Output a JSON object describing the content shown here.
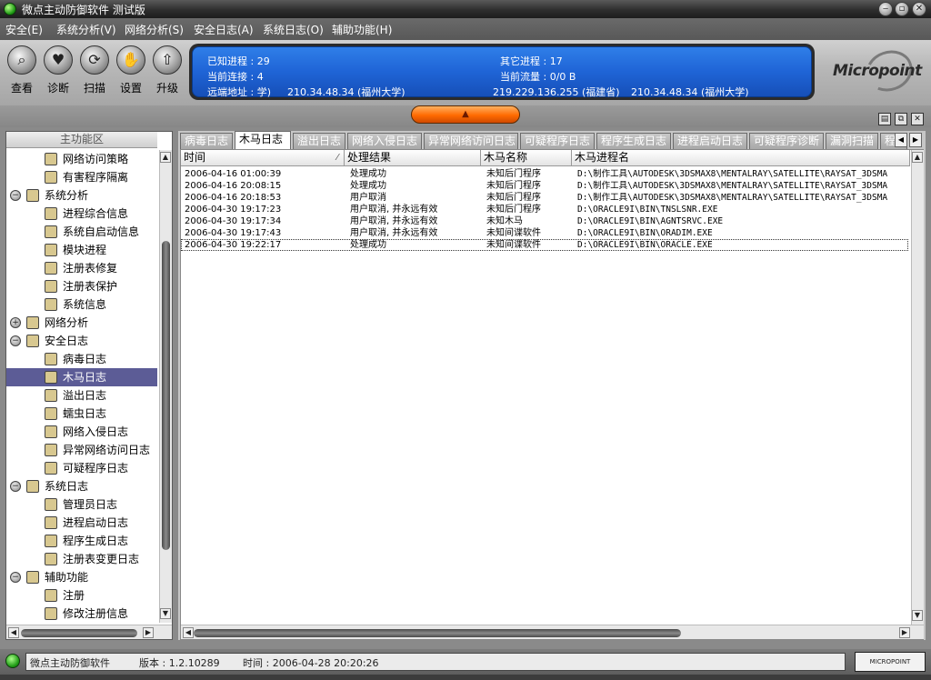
{
  "window": {
    "title": "微点主动防御软件  测试版",
    "buttons": {
      "minimize": "‒",
      "maximize": "▫",
      "close": "✕"
    }
  },
  "menu": [
    "安全(E)",
    "系统分析(V)",
    "网络分析(S)",
    "安全日志(A)",
    "系统日志(O)",
    "辅助功能(H)"
  ],
  "toolbar": {
    "buttons": [
      {
        "label": "查看",
        "icon": "magnifier-icon",
        "glyph": "⌕"
      },
      {
        "label": "诊断",
        "icon": "heart-icon",
        "glyph": "♥"
      },
      {
        "label": "扫描",
        "icon": "scan-icon",
        "glyph": "⟳"
      },
      {
        "label": "设置",
        "icon": "hand-icon",
        "glyph": "✋"
      },
      {
        "label": "升级",
        "icon": "upgrade-icon",
        "glyph": "⇧"
      }
    ]
  },
  "status_panel": {
    "known_processes": "已知进程 : 29",
    "other_processes": "其它进程 : 17",
    "current_connections": "当前连接 : 4",
    "current_traffic": "当前流量 : 0/0 B",
    "remote_label": "远端地址 : 学)",
    "remote_1": "210.34.48.34 (福州大学)",
    "remote_2": "219.229.136.255 (福建省)",
    "remote_3": "210.34.48.34 (福州大学)"
  },
  "logo": {
    "text": "Micropoint"
  },
  "collapse_button": {
    "glyph": "▲"
  },
  "view_controls": [
    "▤",
    "⧉",
    "✕"
  ],
  "left_panel": {
    "header": "主功能区",
    "tree": [
      {
        "label": "网络访问策略",
        "level": 1,
        "icon": "network-policy-icon"
      },
      {
        "label": "有害程序隔离",
        "level": 1,
        "icon": "isolation-icon"
      },
      {
        "label": "系统分析",
        "level": 0,
        "icon": "system-analysis-icon",
        "expander": "−"
      },
      {
        "label": "进程综合信息",
        "level": 1,
        "icon": "process-info-icon"
      },
      {
        "label": "系统自启动信息",
        "level": 1,
        "icon": "autostart-icon"
      },
      {
        "label": "模块进程",
        "level": 1,
        "icon": "module-icon"
      },
      {
        "label": "注册表修复",
        "level": 1,
        "icon": "registry-repair-icon"
      },
      {
        "label": "注册表保护",
        "level": 1,
        "icon": "registry-protect-icon"
      },
      {
        "label": "系统信息",
        "level": 1,
        "icon": "system-info-icon"
      },
      {
        "label": "网络分析",
        "level": 0,
        "icon": "network-analysis-icon",
        "expander": "+"
      },
      {
        "label": "安全日志",
        "level": 0,
        "icon": "security-log-icon",
        "expander": "−"
      },
      {
        "label": "病毒日志",
        "level": 1,
        "icon": "virus-log-icon"
      },
      {
        "label": "木马日志",
        "level": 1,
        "icon": "trojan-log-icon",
        "selected": true
      },
      {
        "label": "溢出日志",
        "level": 1,
        "icon": "overflow-log-icon"
      },
      {
        "label": "蠕虫日志",
        "level": 1,
        "icon": "worm-log-icon"
      },
      {
        "label": "网络入侵日志",
        "level": 1,
        "icon": "intrusion-log-icon"
      },
      {
        "label": "异常网络访问日志",
        "level": 1,
        "icon": "abnormal-access-log-icon"
      },
      {
        "label": "可疑程序日志",
        "level": 1,
        "icon": "suspicious-log-icon"
      },
      {
        "label": "系统日志",
        "level": 0,
        "icon": "system-log-icon",
        "expander": "−"
      },
      {
        "label": "管理员日志",
        "level": 1,
        "icon": "admin-log-icon"
      },
      {
        "label": "进程启动日志",
        "level": 1,
        "icon": "process-start-log-icon"
      },
      {
        "label": "程序生成日志",
        "level": 1,
        "icon": "program-gen-log-icon"
      },
      {
        "label": "注册表变更日志",
        "level": 1,
        "icon": "registry-change-log-icon"
      },
      {
        "label": "辅助功能",
        "level": 0,
        "icon": "assist-icon",
        "expander": "−"
      },
      {
        "label": "注册",
        "level": 1,
        "icon": "register-icon"
      },
      {
        "label": "修改注册信息",
        "level": 1,
        "icon": "modify-register-icon"
      }
    ]
  },
  "tabs": [
    {
      "label": "病毒日志"
    },
    {
      "label": "木马日志",
      "active": true
    },
    {
      "label": "溢出日志"
    },
    {
      "label": "网络入侵日志"
    },
    {
      "label": "异常网络访问日志"
    },
    {
      "label": "可疑程序日志"
    },
    {
      "label": "程序生成日志"
    },
    {
      "label": "进程启动日志"
    },
    {
      "label": "可疑程序诊断"
    },
    {
      "label": "漏洞扫描"
    },
    {
      "label": "程"
    }
  ],
  "table": {
    "columns": [
      "时间",
      "处理结果",
      "木马名称",
      "木马进程名"
    ],
    "sort_indicator": "⁄",
    "rows": [
      [
        "2006-04-16 01:00:39",
        "处理成功",
        "未知后门程序",
        "D:\\制作工具\\AUTODESK\\3DSMAX8\\MENTALRAY\\SATELLITE\\RAYSAT_3DSMA"
      ],
      [
        "2006-04-16 20:08:15",
        "处理成功",
        "未知后门程序",
        "D:\\制作工具\\AUTODESK\\3DSMAX8\\MENTALRAY\\SATELLITE\\RAYSAT_3DSMA"
      ],
      [
        "2006-04-16 20:18:53",
        "用户取消",
        "未知后门程序",
        "D:\\制作工具\\AUTODESK\\3DSMAX8\\MENTALRAY\\SATELLITE\\RAYSAT_3DSMA"
      ],
      [
        "2006-04-30 19:17:23",
        "用户取消, 并永远有效",
        "未知后门程序",
        "D:\\ORACLE9I\\BIN\\TNSLSNR.EXE"
      ],
      [
        "2006-04-30 19:17:34",
        "用户取消, 并永远有效",
        "未知木马",
        "D:\\ORACLE9I\\BIN\\AGNTSRVC.EXE"
      ],
      [
        "2006-04-30 19:17:43",
        "用户取消, 并永远有效",
        "未知间谍软件",
        "D:\\ORACLE9I\\BIN\\ORADIM.EXE"
      ],
      [
        "2006-04-30 19:22:17",
        "处理成功",
        "未知间谍软件",
        "D:\\ORACLE9I\\BIN\\ORACLE.EXE"
      ]
    ],
    "focused_row": 6
  },
  "scroll": {
    "up": "▲",
    "down": "▼",
    "left": "◀",
    "right": "▶"
  },
  "statusbar": {
    "app_name": "微点主动防御软件",
    "version": "版本 : 1.2.10289",
    "time": "时间 : 2006-04-28 20:20:26",
    "brand": "MICROPOINT"
  }
}
